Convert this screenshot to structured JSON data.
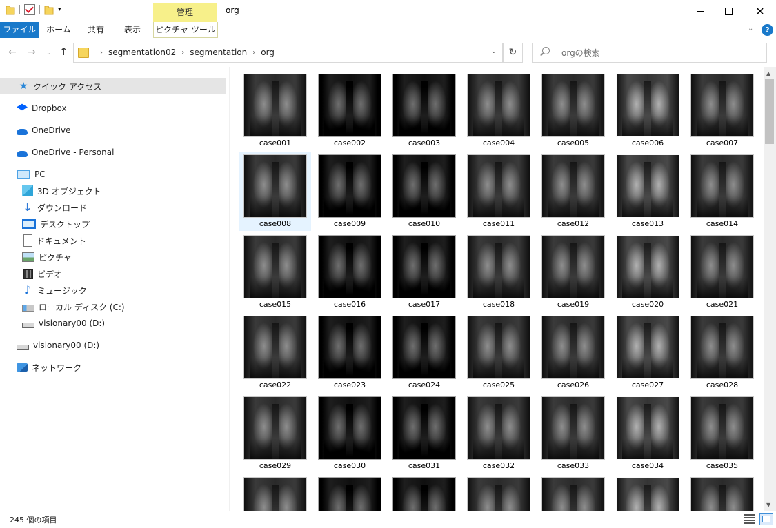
{
  "window": {
    "title": "org",
    "context_tab_header": "管理"
  },
  "ribbon": {
    "tabs": [
      "ファイル",
      "ホーム",
      "共有",
      "表示",
      "ピクチャ ツール"
    ]
  },
  "address": {
    "breadcrumbs": [
      "segmentation02",
      "segmentation",
      "org"
    ]
  },
  "search": {
    "placeholder": "orgの検索"
  },
  "nav": {
    "items": [
      {
        "label": "クイック アクセス",
        "icon": "star-icon"
      },
      {
        "label": "Dropbox",
        "icon": "dropbox-icon"
      },
      {
        "label": "OneDrive",
        "icon": "onedrive-icon"
      },
      {
        "label": "OneDrive - Personal",
        "icon": "onedrive-personal-icon"
      },
      {
        "label": "PC",
        "icon": "pc-icon"
      },
      {
        "label": "3D オブジェクト",
        "icon": "3d-objects-icon"
      },
      {
        "label": "ダウンロード",
        "icon": "download-icon"
      },
      {
        "label": "デスクトップ",
        "icon": "desktop-icon"
      },
      {
        "label": "ドキュメント",
        "icon": "document-icon"
      },
      {
        "label": "ピクチャ",
        "icon": "pictures-icon"
      },
      {
        "label": "ビデオ",
        "icon": "video-icon"
      },
      {
        "label": "ミュージック",
        "icon": "music-icon"
      },
      {
        "label": "ローカル ディスク (C:)",
        "icon": "local-disk-icon"
      },
      {
        "label": "visionary00 (D:)",
        "icon": "drive-icon"
      },
      {
        "label": "visionary00 (D:)",
        "icon": "drive-icon"
      },
      {
        "label": "ネットワーク",
        "icon": "network-icon"
      }
    ]
  },
  "files": [
    "case001",
    "case002",
    "case003",
    "case004",
    "case005",
    "case006",
    "case007",
    "case008",
    "case009",
    "case010",
    "case011",
    "case012",
    "case013",
    "case014",
    "case015",
    "case016",
    "case017",
    "case018",
    "case019",
    "case020",
    "case021",
    "case022",
    "case023",
    "case024",
    "case025",
    "case026",
    "case027",
    "case028",
    "case029",
    "case030",
    "case031",
    "case032",
    "case033",
    "case034",
    "case035",
    "",
    "",
    "",
    "",
    "",
    "",
    ""
  ],
  "selected_file": "case008",
  "status": {
    "item_count": "245 個の項目"
  },
  "colors": {
    "accent": "#1979ca",
    "context_tab": "#f7f08a",
    "selection": "#cce8ff"
  }
}
